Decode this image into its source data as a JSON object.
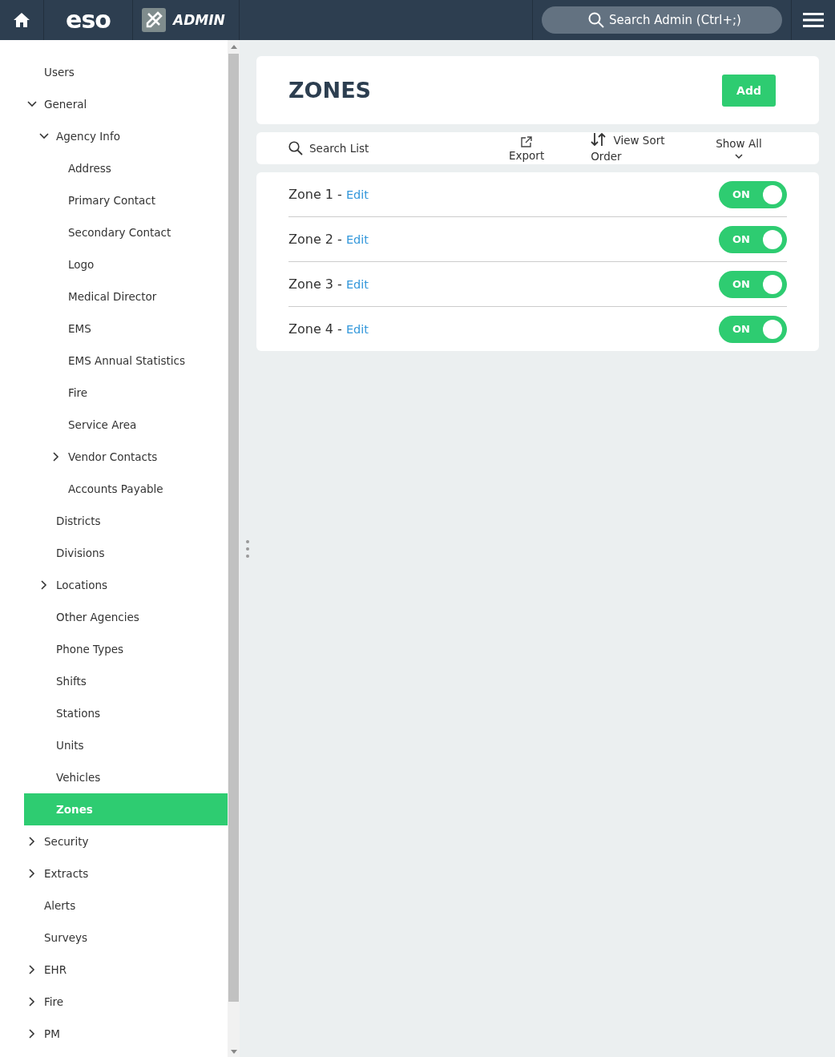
{
  "top_bar": {
    "brand": "eso",
    "section": "ADMIN",
    "search": {
      "placeholder": "Search Admin (Ctrl+;)"
    }
  },
  "sidebar": {
    "items": [
      {
        "label": "Users",
        "selected": false
      },
      {
        "label": "General",
        "selected": false,
        "expanded": true,
        "children": [
          {
            "label": "Agency Info",
            "selected": false,
            "expanded": true,
            "children": [
              {
                "label": "Address",
                "selected": false
              },
              {
                "label": "Primary Contact",
                "selected": false
              },
              {
                "label": "Secondary Contact",
                "selected": false
              },
              {
                "label": "Logo",
                "selected": false
              },
              {
                "label": "Medical Director",
                "selected": false
              },
              {
                "label": "EMS",
                "selected": false
              },
              {
                "label": "EMS Annual Statistics",
                "selected": false
              },
              {
                "label": "Fire",
                "selected": false
              },
              {
                "label": "Service Area",
                "selected": false
              },
              {
                "label": "Vendor Contacts",
                "selected": false,
                "expanded": false
              },
              {
                "label": "Accounts Payable",
                "selected": false
              }
            ]
          },
          {
            "label": "Districts",
            "selected": false
          },
          {
            "label": "Divisions",
            "selected": false
          },
          {
            "label": "Locations",
            "selected": false,
            "expanded": false
          },
          {
            "label": "Other Agencies",
            "selected": false
          },
          {
            "label": "Phone Types",
            "selected": false
          },
          {
            "label": "Shifts",
            "selected": false
          },
          {
            "label": "Stations",
            "selected": false
          },
          {
            "label": "Units",
            "selected": false
          },
          {
            "label": "Vehicles",
            "selected": false
          },
          {
            "label": "Zones",
            "selected": true
          }
        ]
      },
      {
        "label": "Security",
        "selected": false,
        "expanded": false
      },
      {
        "label": "Extracts",
        "selected": false,
        "expanded": false
      },
      {
        "label": "Alerts",
        "selected": false
      },
      {
        "label": "Surveys",
        "selected": false
      },
      {
        "label": "EHR",
        "selected": false,
        "expanded": false
      },
      {
        "label": "Fire",
        "selected": false,
        "expanded": false
      },
      {
        "label": "PM",
        "selected": false,
        "expanded": false
      }
    ]
  },
  "page": {
    "title": "ZONES",
    "add_button": "Add"
  },
  "toolbar": {
    "search": {
      "placeholder": "Search List"
    },
    "export": "Export",
    "sort": "View Sort Order",
    "filter": "Show All"
  },
  "zones": [
    {
      "name": "Zone 1 - ",
      "edit": "Edit",
      "toggle": "ON",
      "on": true
    },
    {
      "name": "Zone 2 - ",
      "edit": "Edit",
      "toggle": "ON",
      "on": true
    },
    {
      "name": "Zone 3 - ",
      "edit": "Edit",
      "toggle": "ON",
      "on": true
    },
    {
      "name": "Zone 4 - ",
      "edit": "Edit",
      "toggle": "ON",
      "on": true
    }
  ]
}
